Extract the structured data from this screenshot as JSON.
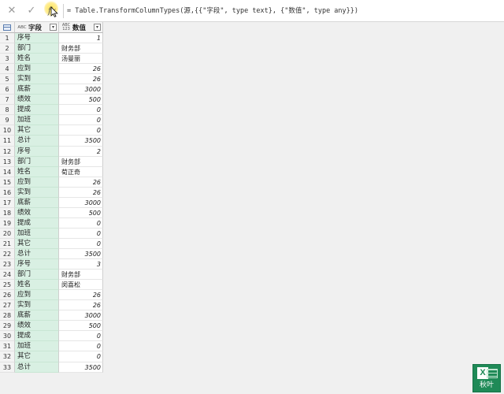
{
  "formula_bar": {
    "cancel_icon": "close-icon",
    "confirm_icon": "check-icon",
    "fx_label": "fx",
    "formula": "= Table.TransformColumnTypes(源,{{\"字段\", type text}, {\"数值\", type any}})"
  },
  "columns": [
    {
      "type_badge": "ABC",
      "label": "字段"
    },
    {
      "type_badge": "ABC\n123",
      "label": "数值"
    }
  ],
  "rows": [
    {
      "n": "1",
      "field": "序号",
      "value": "1",
      "kind": "num"
    },
    {
      "n": "2",
      "field": "部门",
      "value": "财务部",
      "kind": "txt"
    },
    {
      "n": "3",
      "field": "姓名",
      "value": "汤曼丽",
      "kind": "txt"
    },
    {
      "n": "4",
      "field": "应到",
      "value": "26",
      "kind": "num"
    },
    {
      "n": "5",
      "field": "实到",
      "value": "26",
      "kind": "num"
    },
    {
      "n": "6",
      "field": "底薪",
      "value": "3000",
      "kind": "num"
    },
    {
      "n": "7",
      "field": "绩效",
      "value": "500",
      "kind": "num"
    },
    {
      "n": "8",
      "field": "提成",
      "value": "0",
      "kind": "num"
    },
    {
      "n": "9",
      "field": "加班",
      "value": "0",
      "kind": "num"
    },
    {
      "n": "10",
      "field": "其它",
      "value": "0",
      "kind": "num"
    },
    {
      "n": "11",
      "field": "总计",
      "value": "3500",
      "kind": "num"
    },
    {
      "n": "12",
      "field": "序号",
      "value": "2",
      "kind": "num"
    },
    {
      "n": "13",
      "field": "部门",
      "value": "财务部",
      "kind": "txt"
    },
    {
      "n": "14",
      "field": "姓名",
      "value": "荀正奇",
      "kind": "txt"
    },
    {
      "n": "15",
      "field": "应到",
      "value": "26",
      "kind": "num"
    },
    {
      "n": "16",
      "field": "实到",
      "value": "26",
      "kind": "num"
    },
    {
      "n": "17",
      "field": "底薪",
      "value": "3000",
      "kind": "num"
    },
    {
      "n": "18",
      "field": "绩效",
      "value": "500",
      "kind": "num"
    },
    {
      "n": "19",
      "field": "提成",
      "value": "0",
      "kind": "num"
    },
    {
      "n": "20",
      "field": "加班",
      "value": "0",
      "kind": "num"
    },
    {
      "n": "21",
      "field": "其它",
      "value": "0",
      "kind": "num"
    },
    {
      "n": "22",
      "field": "总计",
      "value": "3500",
      "kind": "num"
    },
    {
      "n": "23",
      "field": "序号",
      "value": "3",
      "kind": "num"
    },
    {
      "n": "24",
      "field": "部门",
      "value": "财务部",
      "kind": "txt"
    },
    {
      "n": "25",
      "field": "姓名",
      "value": "闵喜松",
      "kind": "txt"
    },
    {
      "n": "26",
      "field": "应到",
      "value": "26",
      "kind": "num"
    },
    {
      "n": "27",
      "field": "实到",
      "value": "26",
      "kind": "num"
    },
    {
      "n": "28",
      "field": "底薪",
      "value": "3000",
      "kind": "num"
    },
    {
      "n": "29",
      "field": "绩效",
      "value": "500",
      "kind": "num"
    },
    {
      "n": "30",
      "field": "提成",
      "value": "0",
      "kind": "num"
    },
    {
      "n": "31",
      "field": "加班",
      "value": "0",
      "kind": "num"
    },
    {
      "n": "32",
      "field": "其它",
      "value": "0",
      "kind": "num"
    },
    {
      "n": "33",
      "field": "总计",
      "value": "3500",
      "kind": "num"
    }
  ],
  "watermark": {
    "label": "秋叶"
  },
  "colors": {
    "field_column_bg": "#d9f0e3",
    "logo_green": "#1f8a57"
  }
}
